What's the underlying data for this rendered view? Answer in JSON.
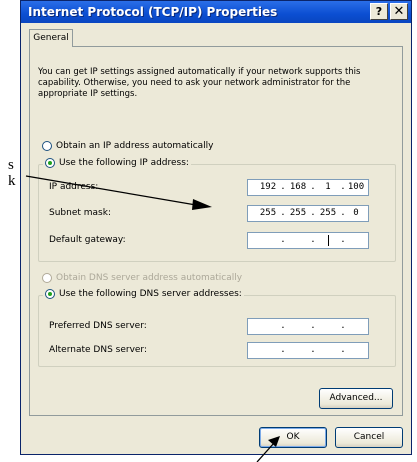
{
  "side_text": {
    "line1": "s",
    "line2": "k"
  },
  "window": {
    "title": "Internet Protocol (TCP/IP) Properties",
    "help_glyph": "?",
    "close_glyph": "✕"
  },
  "tabs": [
    {
      "label": "General",
      "selected": true
    }
  ],
  "intro": "You can get IP settings assigned automatically if your network supports this capability. Otherwise, you need to ask your network administrator for the appropriate IP settings.",
  "ip_section": {
    "auto_label": "Obtain an IP address automatically",
    "auto_selected": false,
    "manual_label": "Use the following IP address:",
    "manual_selected": true,
    "fields": [
      {
        "label": "IP address:",
        "octets": [
          "192",
          "168",
          "1",
          "100"
        ]
      },
      {
        "label": "Subnet mask:",
        "octets": [
          "255",
          "255",
          "255",
          "0"
        ]
      },
      {
        "label": "Default gateway:",
        "octets": [
          "",
          "",
          "",
          ""
        ]
      }
    ]
  },
  "dns_section": {
    "auto_label": "Obtain DNS server address automatically",
    "auto_selected": false,
    "auto_disabled": true,
    "manual_label": "Use the following DNS server addresses:",
    "manual_selected": true,
    "fields": [
      {
        "label": "Preferred DNS server:",
        "octets": [
          "",
          "",
          "",
          ""
        ]
      },
      {
        "label": "Alternate DNS server:",
        "octets": [
          "",
          "",
          "",
          ""
        ]
      }
    ]
  },
  "buttons": {
    "advanced": "Advanced...",
    "ok": "OK",
    "cancel": "Cancel"
  }
}
